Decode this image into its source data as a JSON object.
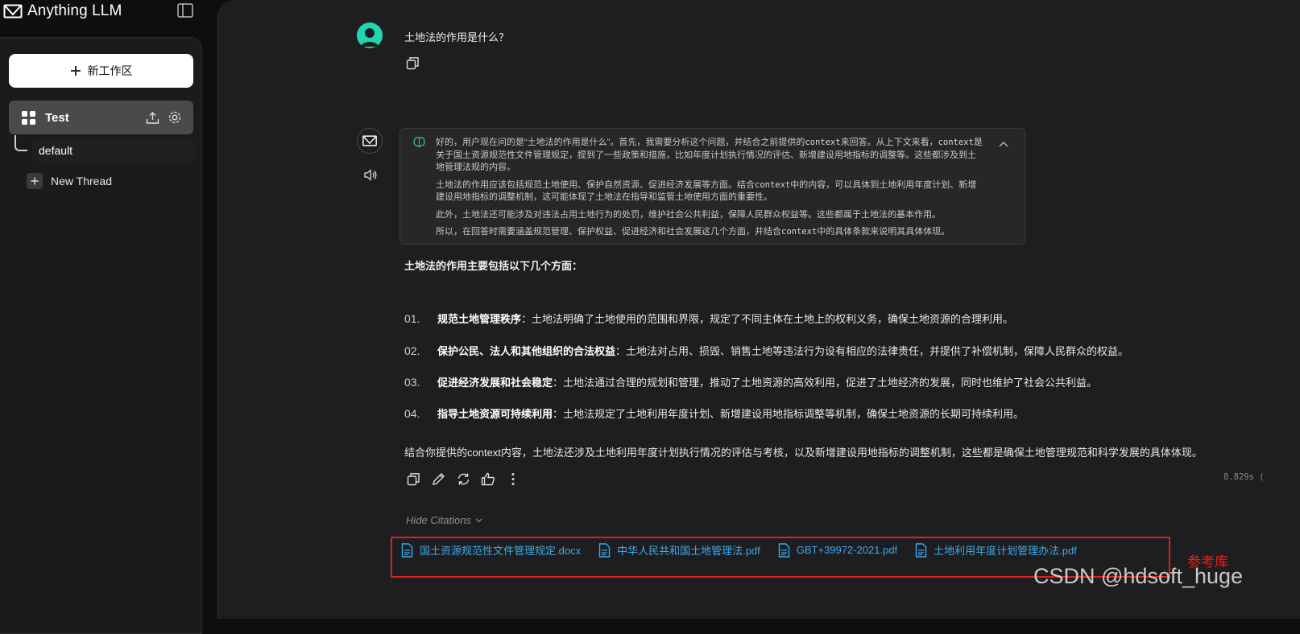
{
  "app": {
    "name": "Anything LLM"
  },
  "sidebar": {
    "new_workspace_label": "新工作区",
    "workspace": {
      "name": "Test"
    },
    "threads": [
      {
        "label": "default"
      }
    ],
    "new_thread_label": "New Thread"
  },
  "chat": {
    "user_question": "土地法的作用是什么？",
    "thinking": {
      "p1_a": "好的，用户现在问的是“土地法的作用是什么”。首先，我需要分析这个问题，并结合之前提供的",
      "p1_code1": "context",
      "p1_b": "来回答。从上下文来看，",
      "p1_code2": "context",
      "p1_c": "是关于国土资源规范性文件管理规定，提到了一些政策和措施，比如年度计划执行情况的评估、新增建设用地指标的调整等。这些都涉及到土地管理法规的内容。",
      "p2_a": "土地法的作用应该包括规范土地使用、保护自然资源、促进经济发展等方面。结合",
      "p2_code": "context",
      "p2_b": "中的内容，可以具体到土地利用年度计划、新增建设用地指标的调整机制，这可能体现了土地法在指导和监管土地使用方面的重要性。",
      "p3": "此外，土地法还可能涉及对违法占用土地行为的处罚，维护社会公共利益，保障人民群众权益等。这些都属于土地法的基本作用。",
      "p4_a": "所以，在回答时需要涵盖规范管理、保护权益、促进经济和社会发展这几个方面，并结合",
      "p4_code": "context",
      "p4_b": "中的具体条款来说明其具体体现。"
    },
    "answer_intro": "土地法的作用主要包括以下几个方面：",
    "answer_items": [
      {
        "num": "01.",
        "title": "规范土地管理秩序",
        "text": "：土地法明确了土地使用的范围和界限，规定了不同主体在土地上的权利义务，确保土地资源的合理利用。"
      },
      {
        "num": "02.",
        "title": "保护公民、法人和其他组织的合法权益",
        "text": "：土地法对占用、损毁、销售土地等违法行为设有相应的法律责任，并提供了补偿机制，保障人民群众的权益。"
      },
      {
        "num": "03.",
        "title": "促进经济发展和社会稳定",
        "text": "：土地法通过合理的规划和管理，推动了土地资源的高效利用，促进了土地经济的发展，同时也维护了社会公共利益。"
      },
      {
        "num": "04.",
        "title": "指导土地资源可持续利用",
        "text": "：土地法规定了土地利用年度计划、新增建设用地指标调整等机制，确保土地资源的长期可持续利用。"
      }
    ],
    "answer_summary": "结合你提供的context内容，土地法还涉及土地利用年度计划执行情况的评估与考核，以及新增建设用地指标的调整机制，这些都是确保土地管理规范和科学发展的具体体现。",
    "timing": "8.829s (",
    "hide_citations_label": "Hide Citations",
    "citations": [
      "国土资源规范性文件管理规定.docx",
      "中华人民共和国土地管理法.pdf",
      "GBT+39972-2021.pdf",
      "土地利用年度计划管理办法.pdf"
    ]
  },
  "annotation": {
    "label": "参考库",
    "color": "#e0201c"
  },
  "watermark": "CSDN @hdsoft_huge",
  "colors": {
    "accent": "#3fa9e8",
    "avatar": "#1fd6b0",
    "background": "#1e1e20",
    "sidebar": "#1b1b1d"
  },
  "icons": {
    "brand": "anything-llm-logo-icon",
    "toggle": "sidebar-toggle-icon",
    "workspace": "grid-icon",
    "upload": "upload-icon",
    "settings": "gear-icon",
    "add": "plus-icon",
    "copy": "copy-icon",
    "edit": "pencil-icon",
    "regenerate": "refresh-icon",
    "like": "thumbs-up-icon",
    "more": "more-vertical-icon",
    "speaker": "speaker-icon",
    "thinking": "brain-icon",
    "collapse": "chevron-up-icon",
    "document": "document-icon"
  }
}
